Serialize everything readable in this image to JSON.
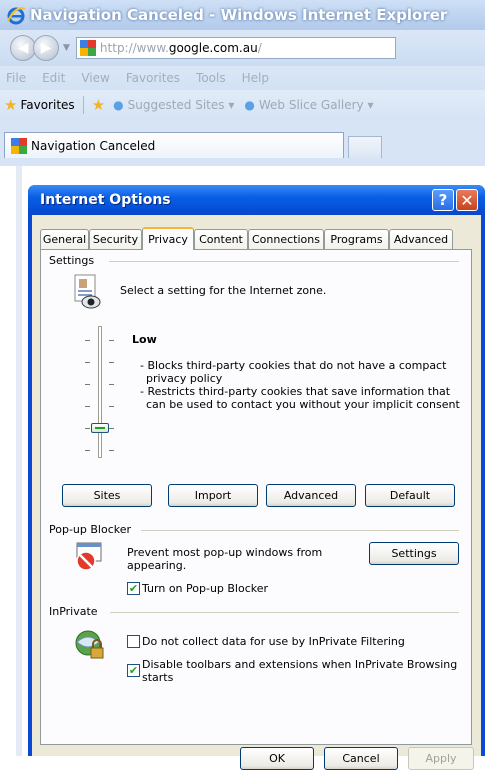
{
  "browser": {
    "window_title": "Navigation Canceled - Windows Internet Explorer",
    "address": {
      "prefix": "http://www.",
      "host": "google.com.au",
      "suffix": "/"
    },
    "menu": [
      "File",
      "Edit",
      "View",
      "Favorites",
      "Tools",
      "Help"
    ],
    "favorites_bar": {
      "favorites_label": "Favorites",
      "suggested_sites": "Suggested Sites ▾",
      "web_slice_gallery": "Web Slice Gallery ▾"
    },
    "tab_title": "Navigation Canceled"
  },
  "dialog": {
    "title": "Internet Options",
    "help_glyph": "?",
    "close_glyph": "✕",
    "tabs": [
      "General",
      "Security",
      "Privacy",
      "Content",
      "Connections",
      "Programs",
      "Advanced"
    ],
    "active_tab": "Privacy",
    "settings": {
      "group_label": "Settings",
      "intro": "Select a setting for the Internet zone.",
      "level": "Low",
      "bullet1_line1": "- Blocks third-party cookies that do not have a compact",
      "bullet1_line2": "privacy policy",
      "bullet2_line1": "- Restricts third-party cookies that save information that",
      "bullet2_line2": "can be used to contact you without your implicit consent",
      "buttons": {
        "sites": "Sites",
        "import": "Import",
        "advanced": "Advanced",
        "default": "Default"
      }
    },
    "popup_blocker": {
      "group_label": "Pop-up Blocker",
      "text_line1": "Prevent most pop-up windows from",
      "text_line2": "appearing.",
      "settings_button": "Settings",
      "checkbox_label": "Turn on Pop-up Blocker",
      "checked": true
    },
    "inprivate": {
      "group_label": "InPrivate",
      "filter_label": "Do not collect data for use by InPrivate Filtering",
      "filter_checked": false,
      "toolbars_label_line1": "Disable toolbars and extensions when InPrivate Browsing",
      "toolbars_label_line2": "starts",
      "toolbars_checked": true
    },
    "footer": {
      "ok": "OK",
      "cancel": "Cancel",
      "apply": "Apply"
    },
    "check_glyph": "✔"
  },
  "colors": {
    "dialog_title_blue": "#0a5fe6",
    "dialog_face": "#ece9d8",
    "close_red": "#c8421f",
    "check_green": "#21a121"
  }
}
